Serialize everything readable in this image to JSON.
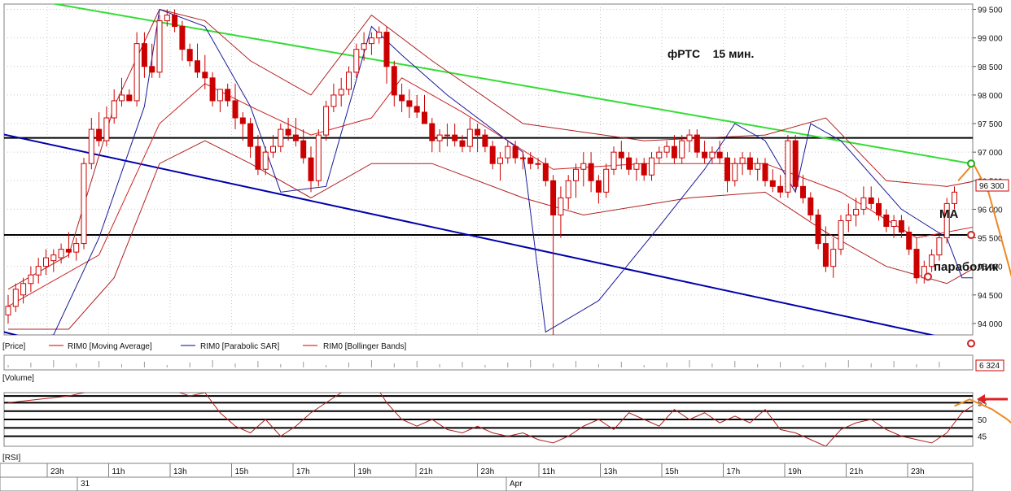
{
  "chart_data": {
    "type": "candlestick",
    "title": "фРТС    15 мин.",
    "x_day_labels": [
      "31",
      "Apr"
    ],
    "x_hour_labels": [
      "23h",
      "11h",
      "13h",
      "15h",
      "17h",
      "19h",
      "21h",
      "23h",
      "11h",
      "13h",
      "15h",
      "17h",
      "19h",
      "21h",
      "23h"
    ],
    "price_axis": {
      "ticks": [
        "99 500",
        "99 000",
        "98 500",
        "98 000",
        "97 500",
        "97 000",
        "96 500",
        "96 000",
        "95 500",
        "95 000",
        "94 500",
        "94 000"
      ],
      "ylim": [
        93800,
        99550
      ],
      "last_price_label": "96 300",
      "last_price": 96300
    },
    "volume_axis": {
      "last_value_label": "6 324"
    },
    "rsi_axis": {
      "ticks": [
        "55",
        "50",
        "45"
      ],
      "ylim": [
        42,
        58
      ],
      "levels": [
        57,
        55,
        52.5,
        50,
        47.5,
        45
      ]
    },
    "legend": [
      {
        "text": "[Price]",
        "color": "#000000"
      },
      {
        "text": "RIM0 [Moving Average]",
        "color": "#cc0000"
      },
      {
        "text": "RIM0 [Parabolic SAR]",
        "color": "#000099"
      },
      {
        "text": "RIM0 [Bollinger Bands]",
        "color": "#cc0000"
      }
    ],
    "panel_labels": {
      "volume": "[Volume]",
      "rsi": "[RSI]"
    },
    "annotations": {
      "ma": "MA",
      "parabolic": "параболик"
    },
    "horizontal_levels": [
      97250,
      95550
    ],
    "trendlines": [
      {
        "name": "resistance",
        "color": "#33dd33",
        "from": [
          6.0,
          99600
        ],
        "to": [
          48.0,
          96800
        ]
      },
      {
        "name": "support",
        "color": "#0000aa",
        "from": [
          -2.0,
          97350
        ],
        "to": [
          48.0,
          93650
        ]
      },
      {
        "name": "support-old",
        "color": "#0000aa",
        "from": [
          -2.0,
          93900
        ],
        "to": [
          2.6,
          93600
        ]
      }
    ],
    "colors": {
      "bear": "#cc0000",
      "bull_outline": "#cc0000",
      "bull_fill": "#ffffff",
      "grid": "#999999"
    },
    "candles": [
      [
        94150,
        94500,
        94000,
        94300
      ],
      [
        94300,
        94700,
        94200,
        94600
      ],
      [
        94500,
        94800,
        94350,
        94700
      ],
      [
        94700,
        95000,
        94550,
        94850
      ],
      [
        94850,
        95150,
        94700,
        95000
      ],
      [
        95000,
        95300,
        94850,
        95150
      ],
      [
        95100,
        95300,
        94900,
        95200
      ],
      [
        95150,
        95400,
        95050,
        95300
      ],
      [
        95300,
        95600,
        95150,
        95250
      ],
      [
        95250,
        95500,
        95100,
        95400
      ],
      [
        95400,
        96900,
        95300,
        96800
      ],
      [
        96800,
        97600,
        96700,
        97400
      ],
      [
        97400,
        97700,
        97100,
        97200
      ],
      [
        97200,
        97800,
        97100,
        97600
      ],
      [
        97600,
        98100,
        97500,
        97900
      ],
      [
        97900,
        98300,
        97800,
        98000
      ],
      [
        98000,
        98100,
        97900,
        97900
      ],
      [
        97900,
        99100,
        97800,
        98900
      ],
      [
        98900,
        99100,
        98300,
        98500
      ],
      [
        98500,
        98900,
        98300,
        98400
      ],
      [
        98400,
        99400,
        98300,
        99300
      ],
      [
        99300,
        99500,
        99200,
        99400
      ],
      [
        99400,
        99500,
        99100,
        99200
      ],
      [
        99200,
        99300,
        98600,
        98800
      ],
      [
        98800,
        98900,
        98500,
        98600
      ],
      [
        98600,
        98900,
        98300,
        98400
      ],
      [
        98400,
        98700,
        98100,
        98300
      ],
      [
        98300,
        98400,
        97800,
        97900
      ],
      [
        97900,
        98100,
        97700,
        98100
      ],
      [
        98100,
        98200,
        97800,
        97900
      ],
      [
        97900,
        98200,
        97400,
        97600
      ],
      [
        97600,
        97700,
        97200,
        97500
      ],
      [
        97500,
        97600,
        96900,
        97100
      ],
      [
        97100,
        97300,
        96600,
        96700
      ],
      [
        96700,
        97100,
        96600,
        97000
      ],
      [
        97000,
        97300,
        96900,
        97100
      ],
      [
        97100,
        97500,
        97000,
        97400
      ],
      [
        97400,
        97600,
        97200,
        97300
      ],
      [
        97300,
        97600,
        97100,
        97200
      ],
      [
        97200,
        97400,
        96800,
        96900
      ],
      [
        96900,
        97100,
        96300,
        96500
      ],
      [
        96500,
        97400,
        96400,
        97300
      ],
      [
        97300,
        97900,
        97200,
        97800
      ],
      [
        97800,
        98200,
        97700,
        98000
      ],
      [
        98000,
        98300,
        97800,
        98100
      ],
      [
        98100,
        98500,
        98000,
        98400
      ],
      [
        98400,
        98900,
        98300,
        98800
      ],
      [
        98800,
        99100,
        98600,
        98900
      ],
      [
        98900,
        99100,
        98700,
        99000
      ],
      [
        99000,
        99200,
        98900,
        99100
      ],
      [
        99100,
        99200,
        98200,
        98500
      ],
      [
        98500,
        98600,
        97800,
        98000
      ],
      [
        98000,
        98200,
        97700,
        97900
      ],
      [
        97900,
        98100,
        97600,
        97800
      ],
      [
        97800,
        98000,
        97600,
        97700
      ],
      [
        97700,
        98000,
        97500,
        97500
      ],
      [
        97500,
        97600,
        97000,
        97200
      ],
      [
        97200,
        97400,
        97000,
        97300
      ],
      [
        97300,
        97500,
        97100,
        97300
      ],
      [
        97300,
        97500,
        97100,
        97200
      ],
      [
        97200,
        97300,
        97000,
        97100
      ],
      [
        97100,
        97600,
        97000,
        97400
      ],
      [
        97400,
        97500,
        97000,
        97300
      ],
      [
        97300,
        97400,
        97000,
        97100
      ],
      [
        97100,
        97200,
        96700,
        96800
      ],
      [
        96800,
        97000,
        96500,
        96900
      ],
      [
        96900,
        97200,
        96800,
        97100
      ],
      [
        97100,
        97200,
        96800,
        96900
      ],
      [
        96900,
        97000,
        96700,
        96900
      ],
      [
        96900,
        97000,
        96700,
        96800
      ],
      [
        96800,
        96900,
        96700,
        96800
      ],
      [
        96800,
        96900,
        96400,
        96500
      ],
      [
        96500,
        96600,
        93800,
        95900
      ],
      [
        95900,
        96400,
        95500,
        96200
      ],
      [
        96200,
        96600,
        96000,
        96500
      ],
      [
        96500,
        96800,
        96200,
        96700
      ],
      [
        96700,
        97000,
        96400,
        96800
      ],
      [
        96800,
        97000,
        96300,
        96500
      ],
      [
        96500,
        96600,
        96100,
        96300
      ],
      [
        96300,
        96800,
        96200,
        96700
      ],
      [
        96700,
        97100,
        96600,
        97000
      ],
      [
        97000,
        97200,
        96700,
        96900
      ],
      [
        96900,
        97000,
        96600,
        96700
      ],
      [
        96700,
        96900,
        96500,
        96800
      ],
      [
        96800,
        96900,
        96500,
        96600
      ],
      [
        96600,
        97000,
        96500,
        96900
      ],
      [
        96900,
        97100,
        96800,
        97000
      ],
      [
        97000,
        97200,
        96900,
        97100
      ],
      [
        97100,
        97300,
        96800,
        96900
      ],
      [
        96900,
        97300,
        96800,
        97200
      ],
      [
        97200,
        97400,
        97000,
        97300
      ],
      [
        97300,
        97400,
        96900,
        97000
      ],
      [
        97000,
        97200,
        96800,
        96900
      ],
      [
        96900,
        97100,
        96800,
        97000
      ],
      [
        97000,
        97200,
        96800,
        96900
      ],
      [
        96900,
        97000,
        96300,
        96500
      ],
      [
        96500,
        96900,
        96400,
        96800
      ],
      [
        96800,
        97000,
        96600,
        96900
      ],
      [
        96900,
        97000,
        96600,
        96700
      ],
      [
        96700,
        96900,
        96500,
        96800
      ],
      [
        96800,
        96900,
        96400,
        96500
      ],
      [
        96500,
        96700,
        96300,
        96400
      ],
      [
        96400,
        96600,
        96200,
        96300
      ],
      [
        96300,
        97300,
        96200,
        97200
      ],
      [
        97200,
        97300,
        96300,
        96400
      ],
      [
        96400,
        96600,
        96100,
        96200
      ],
      [
        96200,
        96300,
        95800,
        95900
      ],
      [
        95900,
        96000,
        95300,
        95400
      ],
      [
        95400,
        95700,
        94900,
        95000
      ],
      [
        95000,
        95500,
        94800,
        95300
      ],
      [
        95300,
        95900,
        95200,
        95800
      ],
      [
        95800,
        96100,
        95600,
        95900
      ],
      [
        95900,
        96200,
        95700,
        96000
      ],
      [
        96000,
        96400,
        95900,
        96200
      ],
      [
        96200,
        96400,
        96000,
        96100
      ],
      [
        96100,
        96200,
        95800,
        95900
      ],
      [
        95900,
        96000,
        95600,
        95700
      ],
      [
        95700,
        95900,
        95500,
        95800
      ],
      [
        95800,
        95900,
        95500,
        95600
      ],
      [
        95600,
        95700,
        95200,
        95300
      ],
      [
        95300,
        95500,
        94700,
        94800
      ],
      [
        94800,
        95100,
        94700,
        95000
      ],
      [
        95000,
        95300,
        94900,
        95200
      ],
      [
        95200,
        95600,
        95100,
        95500
      ],
      [
        95500,
        96200,
        95400,
        96100
      ],
      [
        96100,
        96400,
        96000,
        96300
      ]
    ],
    "moving_average": [
      [
        0,
        94300
      ],
      [
        12,
        95200
      ],
      [
        20,
        97500
      ],
      [
        26,
        98200
      ],
      [
        32,
        97800
      ],
      [
        40,
        97300
      ],
      [
        48,
        97600
      ],
      [
        52,
        98300
      ],
      [
        60,
        97700
      ],
      [
        72,
        96700
      ],
      [
        84,
        96800
      ],
      [
        100,
        96800
      ],
      [
        110,
        96300
      ],
      [
        120,
        95500
      ],
      [
        128,
        95700
      ]
    ],
    "bollinger_upper": [
      [
        0,
        94600
      ],
      [
        8,
        95200
      ],
      [
        14,
        97800
      ],
      [
        20,
        99500
      ],
      [
        26,
        99300
      ],
      [
        32,
        98600
      ],
      [
        40,
        98000
      ],
      [
        48,
        99400
      ],
      [
        56,
        98600
      ],
      [
        68,
        97500
      ],
      [
        84,
        97200
      ],
      [
        100,
        97300
      ],
      [
        108,
        97600
      ],
      [
        116,
        96500
      ],
      [
        124,
        96400
      ],
      [
        128,
        96500
      ]
    ],
    "bollinger_lower": [
      [
        0,
        93900
      ],
      [
        8,
        93900
      ],
      [
        14,
        94800
      ],
      [
        20,
        96800
      ],
      [
        26,
        97200
      ],
      [
        32,
        96800
      ],
      [
        40,
        96200
      ],
      [
        48,
        96800
      ],
      [
        56,
        96800
      ],
      [
        68,
        96200
      ],
      [
        76,
        95900
      ],
      [
        90,
        96200
      ],
      [
        100,
        96300
      ],
      [
        108,
        95600
      ],
      [
        116,
        95000
      ],
      [
        124,
        94700
      ],
      [
        128,
        95000
      ]
    ],
    "parabolic_sar": [
      [
        0,
        93700
      ],
      [
        6,
        93800
      ],
      [
        12,
        95500
      ],
      [
        18,
        97800
      ],
      [
        20,
        99500
      ],
      [
        26,
        99200
      ],
      [
        32,
        97800
      ],
      [
        36,
        96300
      ],
      [
        42,
        96400
      ],
      [
        48,
        99200
      ],
      [
        52,
        98700
      ],
      [
        58,
        98000
      ],
      [
        68,
        97000
      ],
      [
        71,
        93850
      ],
      [
        78,
        94400
      ],
      [
        86,
        95700
      ],
      [
        92,
        96700
      ],
      [
        96,
        97500
      ],
      [
        100,
        97200
      ],
      [
        104,
        96300
      ],
      [
        106,
        97500
      ],
      [
        110,
        97200
      ],
      [
        118,
        96000
      ],
      [
        124,
        95500
      ],
      [
        126,
        94800
      ],
      [
        128,
        94800
      ]
    ],
    "rsi": [
      [
        0,
        55
      ],
      [
        4,
        56
      ],
      [
        8,
        57
      ],
      [
        12,
        59
      ],
      [
        20,
        60
      ],
      [
        24,
        57
      ],
      [
        26,
        58
      ],
      [
        28,
        52
      ],
      [
        30,
        48
      ],
      [
        32,
        46
      ],
      [
        34,
        50
      ],
      [
        36,
        45
      ],
      [
        38,
        48
      ],
      [
        40,
        52
      ],
      [
        42,
        55
      ],
      [
        44,
        58
      ],
      [
        46,
        60
      ],
      [
        48,
        62
      ],
      [
        50,
        55
      ],
      [
        52,
        50
      ],
      [
        54,
        48
      ],
      [
        56,
        50
      ],
      [
        58,
        47
      ],
      [
        60,
        46
      ],
      [
        62,
        48
      ],
      [
        64,
        46
      ],
      [
        66,
        45
      ],
      [
        68,
        46
      ],
      [
        70,
        44
      ],
      [
        72,
        43
      ],
      [
        74,
        45
      ],
      [
        76,
        48
      ],
      [
        78,
        50
      ],
      [
        80,
        47
      ],
      [
        82,
        52
      ],
      [
        84,
        50
      ],
      [
        86,
        48
      ],
      [
        88,
        53
      ],
      [
        90,
        50
      ],
      [
        92,
        52
      ],
      [
        94,
        49
      ],
      [
        96,
        51
      ],
      [
        98,
        49
      ],
      [
        100,
        53
      ],
      [
        102,
        47
      ],
      [
        104,
        46
      ],
      [
        106,
        44
      ],
      [
        108,
        42
      ],
      [
        110,
        47
      ],
      [
        112,
        49
      ],
      [
        114,
        50
      ],
      [
        116,
        47
      ],
      [
        118,
        45
      ],
      [
        120,
        44
      ],
      [
        122,
        43
      ],
      [
        124,
        46
      ],
      [
        126,
        52
      ],
      [
        128,
        55
      ]
    ],
    "forecast_price": [
      [
        125.5,
        96500
      ],
      [
        127.5,
        96800
      ],
      [
        129.5,
        96300
      ],
      [
        132,
        95100
      ],
      [
        135,
        93600
      ]
    ],
    "forecast_rsi": [
      [
        125,
        54
      ],
      [
        127,
        56
      ],
      [
        130,
        53
      ],
      [
        132,
        50
      ],
      [
        134,
        46
      ]
    ]
  }
}
